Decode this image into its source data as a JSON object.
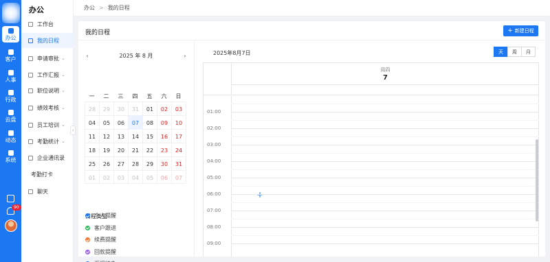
{
  "rail": {
    "items": [
      {
        "label": "办公",
        "icon": "briefcase-icon",
        "active": true
      },
      {
        "label": "客户",
        "icon": "customer-icon"
      },
      {
        "label": "人事",
        "icon": "person-icon"
      },
      {
        "label": "行政",
        "icon": "admin-icon"
      },
      {
        "label": "云盘",
        "icon": "cloud-drive-icon"
      },
      {
        "label": "动态",
        "icon": "feed-icon"
      },
      {
        "label": "系统",
        "icon": "system-icon"
      }
    ],
    "notification_count": "90"
  },
  "sidebar": {
    "title": "办公",
    "items": [
      {
        "label": "工作台",
        "icon": "monitor-icon"
      },
      {
        "label": "我的日程",
        "icon": "calendar-icon",
        "active": true
      },
      {
        "label": "申请审批",
        "icon": "document-icon",
        "expandable": true
      },
      {
        "label": "工作汇报",
        "icon": "report-icon",
        "expandable": true
      },
      {
        "label": "职位说明",
        "icon": "position-icon",
        "expandable": true
      },
      {
        "label": "绩效考核",
        "icon": "performance-icon",
        "expandable": true
      },
      {
        "label": "员工培训",
        "icon": "training-icon",
        "expandable": true
      },
      {
        "label": "考勤统计",
        "icon": "stats-icon",
        "expandable": true
      },
      {
        "label": "企业通讯录",
        "icon": "contacts-icon"
      },
      {
        "label": "考勤打卡",
        "icon": ""
      },
      {
        "label": "聊天",
        "icon": "chat-icon"
      }
    ]
  },
  "breadcrumb": {
    "root": "办公",
    "separator": ">",
    "current": "我的日程"
  },
  "page": {
    "title": "我的日程",
    "new_button": "新建日程"
  },
  "mini_calendar": {
    "month_label": "2025 年 8 月",
    "weekdays": [
      "一",
      "二",
      "三",
      "四",
      "五",
      "六",
      "日"
    ],
    "weeks": [
      [
        "28",
        "29",
        "30",
        "31",
        "01",
        "02",
        "03"
      ],
      [
        "04",
        "05",
        "06",
        "07",
        "08",
        "09",
        "10"
      ],
      [
        "11",
        "12",
        "13",
        "14",
        "15",
        "16",
        "17"
      ],
      [
        "18",
        "19",
        "20",
        "21",
        "22",
        "23",
        "24"
      ],
      [
        "25",
        "26",
        "27",
        "28",
        "29",
        "30",
        "31"
      ],
      [
        "01",
        "02",
        "03",
        "04",
        "05",
        "06",
        "07"
      ]
    ],
    "selected": "07"
  },
  "schedule_types": {
    "title": "日程类型",
    "items": [
      {
        "label": "个人提醒",
        "color": "#1b78f2"
      },
      {
        "label": "客户跟进",
        "color": "#2fb85f"
      },
      {
        "label": "续费提醒",
        "color": "#f07b3f"
      },
      {
        "label": "回款提醒",
        "color": "#9a5fe6"
      },
      {
        "label": "汇报待办",
        "color": "#1b78f2"
      }
    ]
  },
  "day_view": {
    "date_label": "2025年8月7日",
    "views": [
      "天",
      "周",
      "月"
    ],
    "active_view": "天",
    "weekday": "周四",
    "day_number": "7",
    "hours": [
      "01:00",
      "02:00",
      "03:00",
      "04:00",
      "05:00",
      "06:00",
      "07:00",
      "08:00",
      "09:00"
    ]
  }
}
